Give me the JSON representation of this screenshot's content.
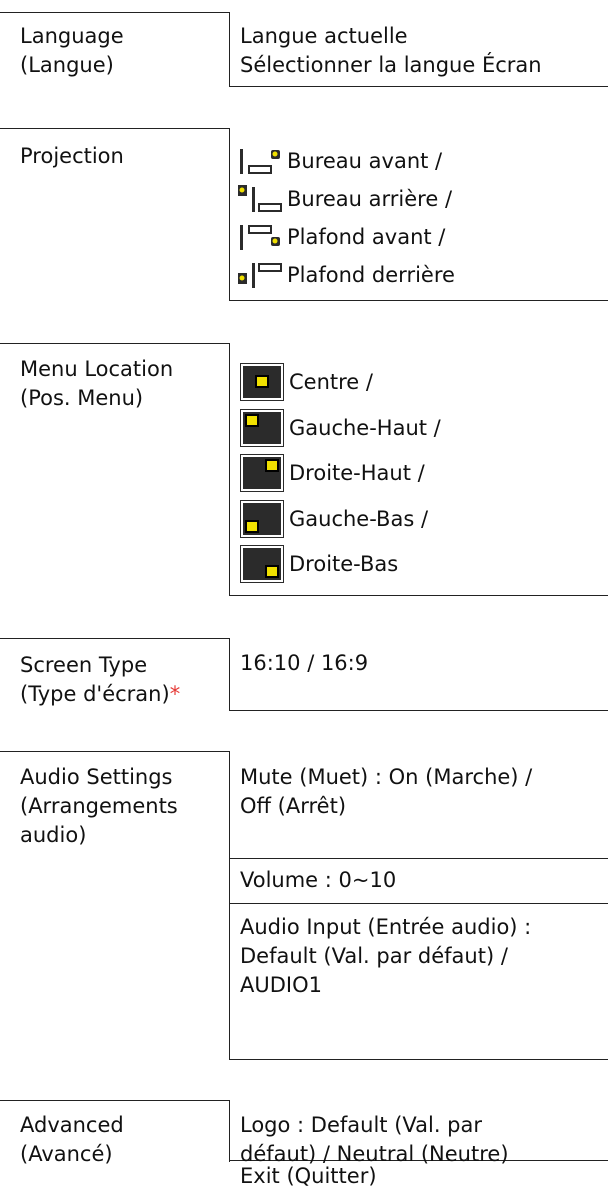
{
  "sections": [
    {
      "label": [
        "Language",
        "(Langue)"
      ],
      "values": [
        "Langue actuelle",
        "Sélectionner la langue Écran"
      ]
    },
    {
      "label": [
        "Projection"
      ],
      "items": [
        {
          "icon": "projector-desktop-front-icon",
          "text": "Bureau avant /"
        },
        {
          "icon": "projector-desktop-rear-icon",
          "text": "Bureau arrière /"
        },
        {
          "icon": "projector-ceiling-front-icon",
          "text": "Plafond avant /"
        },
        {
          "icon": "projector-ceiling-rear-icon",
          "text": "Plafond derrière"
        }
      ]
    },
    {
      "label": [
        "Menu Location",
        "(Pos. Menu)"
      ],
      "items": [
        {
          "icon": "menu-position-center-icon",
          "text": "Centre /"
        },
        {
          "icon": "menu-position-top-left-icon",
          "text": "Gauche-Haut /"
        },
        {
          "icon": "menu-position-top-right-icon",
          "text": "Droite-Haut /"
        },
        {
          "icon": "menu-position-bottom-left-icon",
          "text": "Gauche-Bas /"
        },
        {
          "icon": "menu-position-bottom-right-icon",
          "text": "Droite-Bas"
        }
      ]
    },
    {
      "label": [
        "Screen Type",
        "(Type d'écran)"
      ],
      "asterisk": "*",
      "value": "16:10 / 16:9"
    },
    {
      "label": [
        "Audio Settings",
        "(Arrangements",
        "audio)"
      ],
      "rows": [
        [
          "Mute (Muet) : On (Marche) /",
          "Off (Arrêt)"
        ],
        [
          "Volume : 0~10"
        ],
        [
          "Audio Input (Entrée audio) :",
          "Default (Val. par défaut) /",
          "AUDIO1"
        ]
      ]
    },
    {
      "label": [
        "Advanced",
        "(Avancé)"
      ],
      "rows": [
        [
          "Logo : Default (Val. par",
          "défaut) / Neutral (Neutre)"
        ],
        [
          "Exit (Quitter)"
        ]
      ]
    }
  ],
  "colors": {
    "line": "#222222",
    "asterisk": "#e53935",
    "icon_dark": "#2b2b2b",
    "icon_yellow": "#f0e000"
  }
}
